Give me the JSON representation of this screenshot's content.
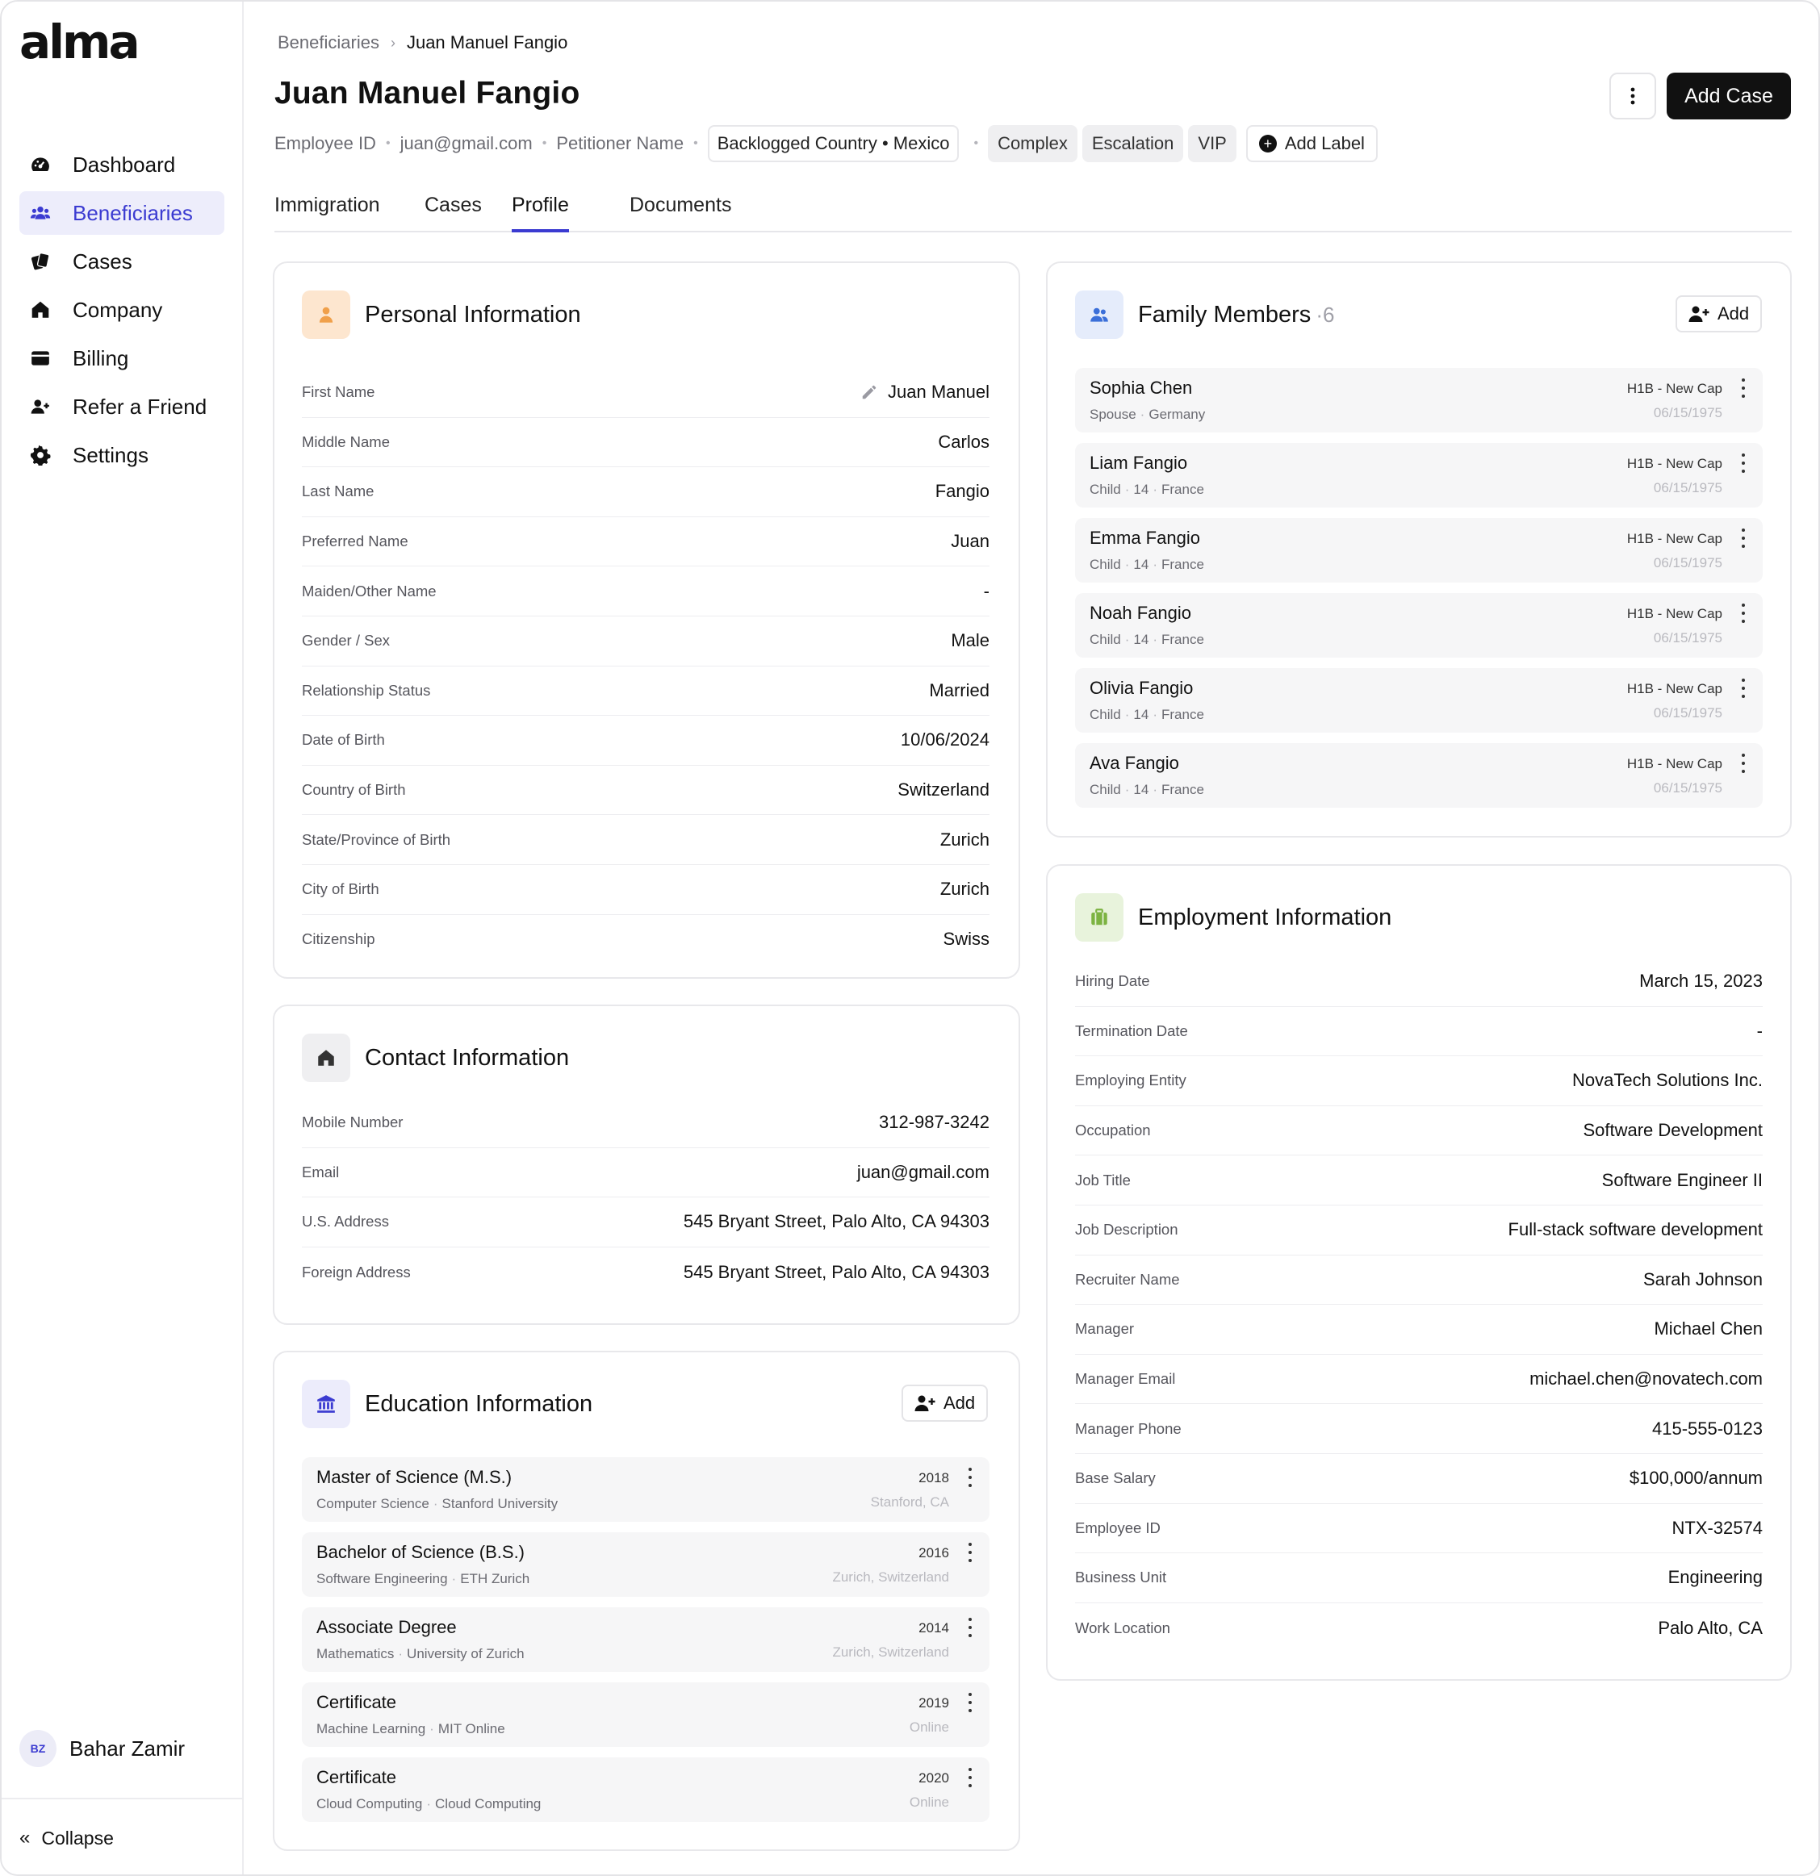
{
  "app": {
    "logo": "alma"
  },
  "sidebar": {
    "items": [
      {
        "label": "Dashboard",
        "icon": "dashboard-icon",
        "active": false
      },
      {
        "label": "Beneficiaries",
        "icon": "users-icon",
        "active": true
      },
      {
        "label": "Cases",
        "icon": "cases-icon",
        "active": false
      },
      {
        "label": "Company",
        "icon": "home-icon",
        "active": false
      },
      {
        "label": "Billing",
        "icon": "wallet-icon",
        "active": false
      },
      {
        "label": "Refer a Friend",
        "icon": "user-plus-icon",
        "active": false
      },
      {
        "label": "Settings",
        "icon": "gear-icon",
        "active": false
      }
    ],
    "user": {
      "initials": "BZ",
      "name": "Bahar Zamir"
    },
    "collapse_label": "Collapse"
  },
  "header": {
    "breadcrumb": {
      "parent": "Beneficiaries",
      "current": "Juan Manuel Fangio"
    },
    "title": "Juan Manuel Fangio",
    "add_case_label": "Add Case",
    "meta": {
      "employee_id": "Employee ID",
      "email": "juan@gmail.com",
      "petitioner": "Petitioner Name",
      "country_chip": "Backlogged Country • Mexico",
      "labels": [
        "Complex",
        "Escalation",
        "VIP"
      ],
      "add_label": "Add Label"
    },
    "tabs": [
      {
        "label": "Immigration",
        "active": false
      },
      {
        "label": "Cases",
        "active": false
      },
      {
        "label": "Profile",
        "active": true
      },
      {
        "label": "Documents",
        "active": false
      }
    ]
  },
  "personal": {
    "title": "Personal Information",
    "rows": [
      {
        "label": "First Name",
        "value": "Juan Manuel"
      },
      {
        "label": "Middle Name",
        "value": "Carlos"
      },
      {
        "label": "Last Name",
        "value": "Fangio"
      },
      {
        "label": "Preferred Name",
        "value": "Juan"
      },
      {
        "label": "Maiden/Other Name",
        "value": "-"
      },
      {
        "label": "Gender / Sex",
        "value": "Male"
      },
      {
        "label": "Relationship Status",
        "value": "Married"
      },
      {
        "label": "Date of Birth",
        "value": "10/06/2024"
      },
      {
        "label": "Country of Birth",
        "value": "Switzerland"
      },
      {
        "label": "State/Province of Birth",
        "value": "Zurich"
      },
      {
        "label": "City of Birth",
        "value": "Zurich"
      },
      {
        "label": "Citizenship",
        "value": "Swiss"
      }
    ]
  },
  "contact": {
    "title": "Contact Information",
    "rows": [
      {
        "label": "Mobile Number",
        "value": "312-987-3242"
      },
      {
        "label": "Email",
        "value": "juan@gmail.com"
      },
      {
        "label": "U.S. Address",
        "value": "545 Bryant Street, Palo Alto, CA 94303"
      },
      {
        "label": "Foreign Address",
        "value": "545 Bryant Street, Palo Alto, CA 94303"
      }
    ]
  },
  "education": {
    "title": "Education Information",
    "add_label": "Add",
    "items": [
      {
        "title": "Master of Science (M.S.)",
        "field": "Computer Science",
        "school": "Stanford University",
        "year": "2018",
        "location": "Stanford, CA"
      },
      {
        "title": "Bachelor of Science (B.S.)",
        "field": "Software Engineering",
        "school": "ETH Zurich",
        "year": "2016",
        "location": "Zurich, Switzerland"
      },
      {
        "title": "Associate Degree",
        "field": "Mathematics",
        "school": "University of Zurich",
        "year": "2014",
        "location": "Zurich, Switzerland"
      },
      {
        "title": "Certificate",
        "field": "Machine Learning",
        "school": "MIT Online",
        "year": "2019",
        "location": "Online"
      },
      {
        "title": "Certificate",
        "field": "Cloud Computing",
        "school": "Cloud Computing",
        "year": "2020",
        "location": "Online"
      }
    ]
  },
  "family": {
    "title": "Family Members",
    "count": "6",
    "add_label": "Add",
    "members": [
      {
        "name": "Sophia Chen",
        "relation": "Spouse",
        "age": "",
        "country": "Germany",
        "visa": "H1B - New Cap",
        "date": "06/15/1975"
      },
      {
        "name": "Liam Fangio",
        "relation": "Child",
        "age": "14",
        "country": "France",
        "visa": "H1B - New Cap",
        "date": "06/15/1975"
      },
      {
        "name": "Emma Fangio",
        "relation": "Child",
        "age": "14",
        "country": "France",
        "visa": "H1B - New Cap",
        "date": "06/15/1975"
      },
      {
        "name": "Noah Fangio",
        "relation": "Child",
        "age": "14",
        "country": "France",
        "visa": "H1B - New Cap",
        "date": "06/15/1975"
      },
      {
        "name": "Olivia Fangio",
        "relation": "Child",
        "age": "14",
        "country": "France",
        "visa": "H1B - New Cap",
        "date": "06/15/1975"
      },
      {
        "name": "Ava Fangio",
        "relation": "Child",
        "age": "14",
        "country": "France",
        "visa": "H1B - New Cap",
        "date": "06/15/1975"
      }
    ]
  },
  "employment": {
    "title": "Employment Information",
    "rows": [
      {
        "label": "Hiring Date",
        "value": "March 15, 2023"
      },
      {
        "label": "Termination Date",
        "value": "-"
      },
      {
        "label": "Employing Entity",
        "value": "NovaTech Solutions Inc."
      },
      {
        "label": "Occupation",
        "value": "Software Development"
      },
      {
        "label": "Job Title",
        "value": "Software Engineer II"
      },
      {
        "label": "Job Description",
        "value": "Full-stack software development"
      },
      {
        "label": "Recruiter Name",
        "value": "Sarah Johnson"
      },
      {
        "label": "Manager",
        "value": "Michael Chen"
      },
      {
        "label": "Manager Email",
        "value": "michael.chen@novatech.com"
      },
      {
        "label": "Manager Phone",
        "value": "415-555-0123"
      },
      {
        "label": "Base Salary",
        "value": "$100,000/annum"
      },
      {
        "label": "Employee ID",
        "value": "NTX-32574"
      },
      {
        "label": "Business Unit",
        "value": "Engineering"
      },
      {
        "label": "Work Location",
        "value": "Palo Alto, CA"
      }
    ]
  },
  "colors": {
    "accent": "#3b3bd1",
    "accent_bg": "#ededfb",
    "primary_button": "#111111",
    "personal_icon_bg": "#fde6cf",
    "personal_icon": "#f0a04b",
    "family_icon_bg": "#e5ecfb",
    "family_icon": "#3b6fd9",
    "employment_icon_bg": "#e8f3dc",
    "employment_icon": "#7cb342",
    "education_icon_bg": "#ececfb",
    "education_icon": "#3b3bd1"
  }
}
